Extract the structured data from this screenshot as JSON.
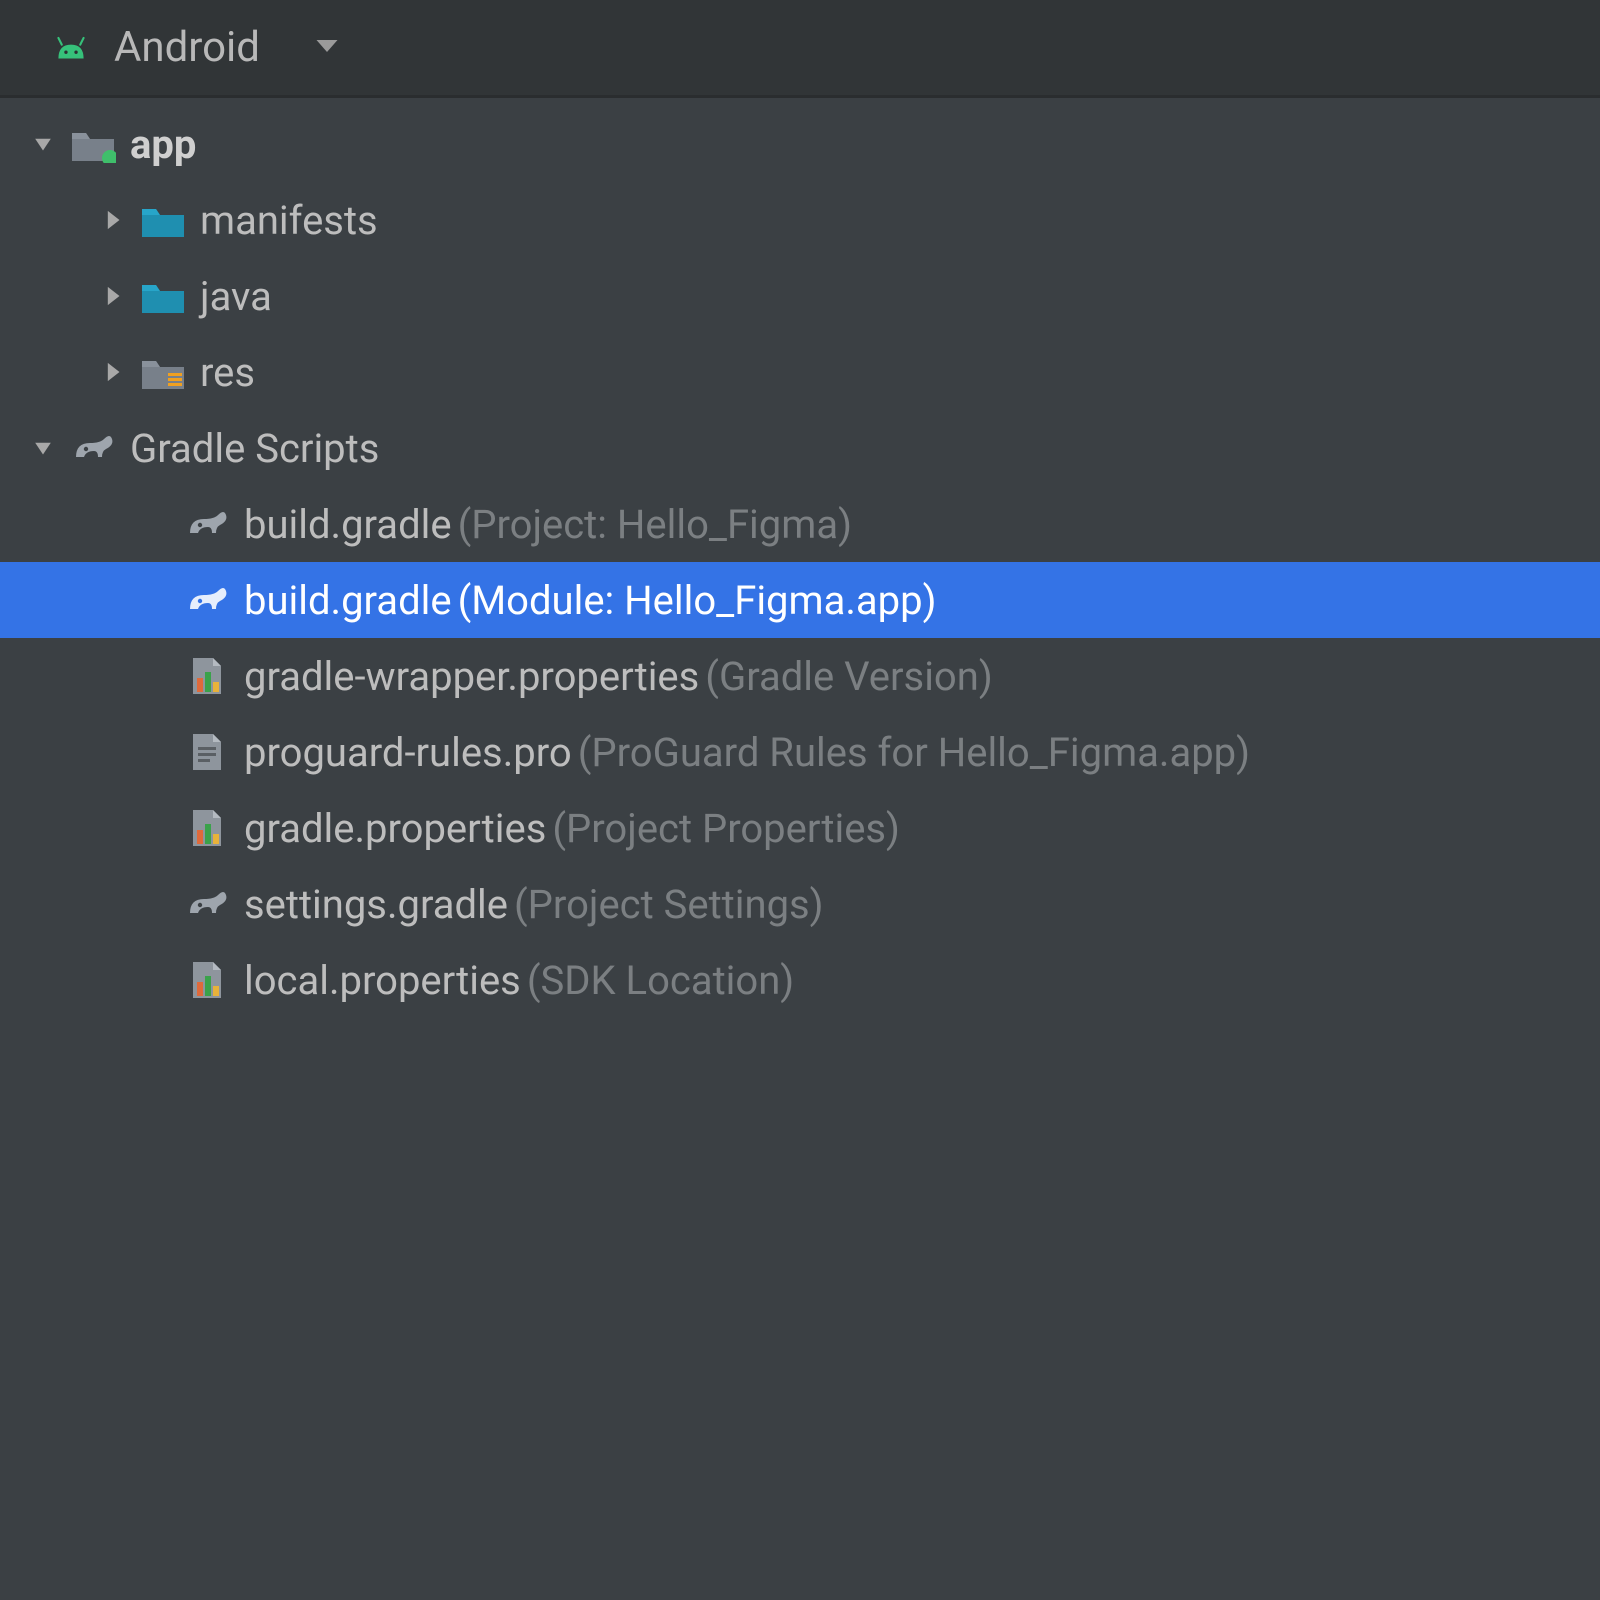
{
  "header": {
    "view_label": "Android"
  },
  "tree": {
    "app": {
      "label": "app",
      "children": {
        "manifests": "manifests",
        "java": "java",
        "res": "res"
      }
    },
    "gradle": {
      "label": "Gradle Scripts",
      "items": [
        {
          "name": "build.gradle",
          "hint": " (Project: Hello_Figma)",
          "icon": "gradle"
        },
        {
          "name": "build.gradle",
          "hint": " (Module: Hello_Figma.app)",
          "icon": "gradle",
          "selected": true
        },
        {
          "name": "gradle-wrapper.properties",
          "hint": " (Gradle Version)",
          "icon": "props"
        },
        {
          "name": "proguard-rules.pro",
          "hint": " (ProGuard Rules for Hello_Figma.app)",
          "icon": "text"
        },
        {
          "name": "gradle.properties",
          "hint": " (Project Properties)",
          "icon": "props"
        },
        {
          "name": "settings.gradle",
          "hint": " (Project Settings)",
          "icon": "gradle"
        },
        {
          "name": "local.properties",
          "hint": " (SDK Location)",
          "icon": "props"
        }
      ]
    }
  }
}
